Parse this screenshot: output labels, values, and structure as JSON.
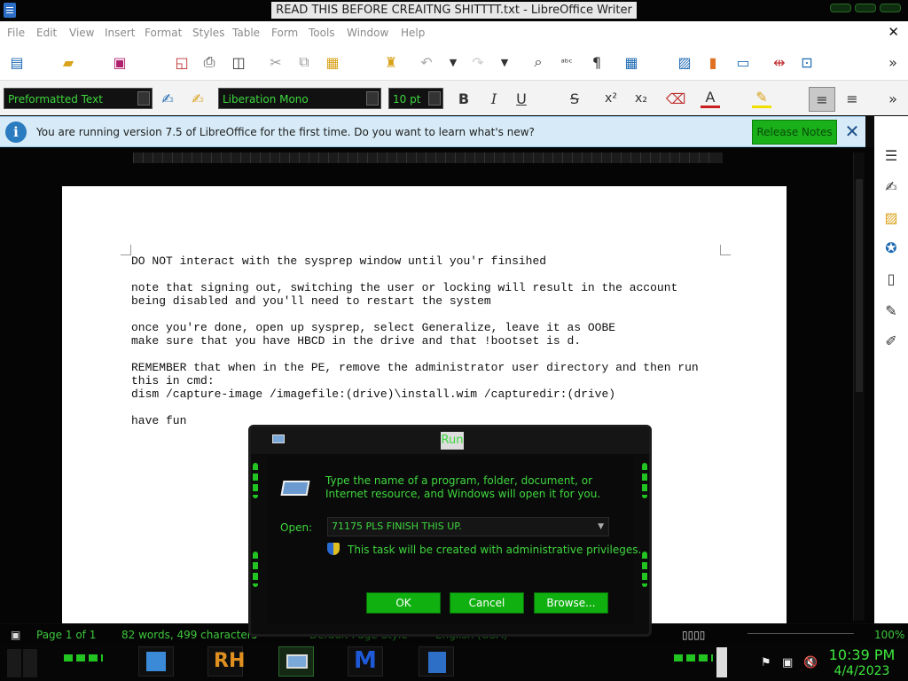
{
  "window": {
    "title": "READ THIS BEFORE CREAITNG SHITTTT.txt - LibreOffice Writer"
  },
  "menubar": {
    "items": [
      "File",
      "Edit",
      "View",
      "Insert",
      "Format",
      "Styles",
      "Table",
      "Form",
      "Tools",
      "Window",
      "Help"
    ],
    "close_glyph": "✕"
  },
  "format_bar": {
    "paragraph_style": "Preformatted Text",
    "font_name": "Liberation Mono",
    "font_size": "10 pt",
    "bold": "B",
    "italic": "I",
    "underline": "U",
    "strikethrough": "S",
    "superscript": "x²",
    "subscript": "x₂"
  },
  "infobar": {
    "message": "You are running version 7.5 of LibreOffice for the first time. Do you want to learn what's new?",
    "button_label": "Release Notes",
    "info_glyph": "i",
    "close_glyph": "✕"
  },
  "document": {
    "line1": "DO NOT interact with the sysprep window until you'r finsihed",
    "line2a": "note that signing out, switching the user or locking will result in the account",
    "line2b": "being disabled and you'll need to restart the system",
    "line3a": "once you're done, open up sysprep, select Generalize, leave it as OOBE",
    "line3b": "make sure that you have HBCD in the drive and that !bootset is d.",
    "line4a": "REMEMBER that when in the PE, remove the administrator user directory and then run",
    "line4b": "this in cmd:",
    "line4c": "dism /capture-image /imagefile:(drive)\\install.wim /capturedir:(drive)",
    "line5": "have fun"
  },
  "statusbar": {
    "page": "Page 1 of 1",
    "words": "82 words, 499 characters",
    "page_style": "Default Page Style",
    "language": "English (USA)",
    "zoom": "100%"
  },
  "run_dialog": {
    "title": "Run",
    "description": "Type the name of a program, folder, document, or Internet resource, and Windows will open it for you.",
    "open_label": "Open:",
    "input_value": "71175 PLS FINISH THIS UP.",
    "admin_note": "This task will be created with administrative privileges.",
    "ok_label": "OK",
    "cancel_label": "Cancel",
    "browse_label": "Browse..."
  },
  "taskbar": {
    "rh_label": "RH",
    "time": "10:39 PM",
    "date": "4/4/2023"
  },
  "colors": {
    "accent_green": "#3ed83e",
    "button_green": "#10b010",
    "infobar_bg": "#d6ebf7"
  },
  "icons": [
    "document-icon",
    "open-folder-icon",
    "save-icon",
    "export-pdf-icon",
    "print-icon",
    "print-preview-icon",
    "cut-icon",
    "copy-icon",
    "paste-icon",
    "clone-formatting-icon",
    "undo-icon",
    "redo-icon",
    "find-replace-icon",
    "spelling-icon",
    "formatting-marks-icon",
    "insert-table-icon",
    "insert-image-icon",
    "insert-chart-icon",
    "insert-textbox-icon",
    "page-break-icon",
    "insert-field-icon",
    "more-icon"
  ]
}
